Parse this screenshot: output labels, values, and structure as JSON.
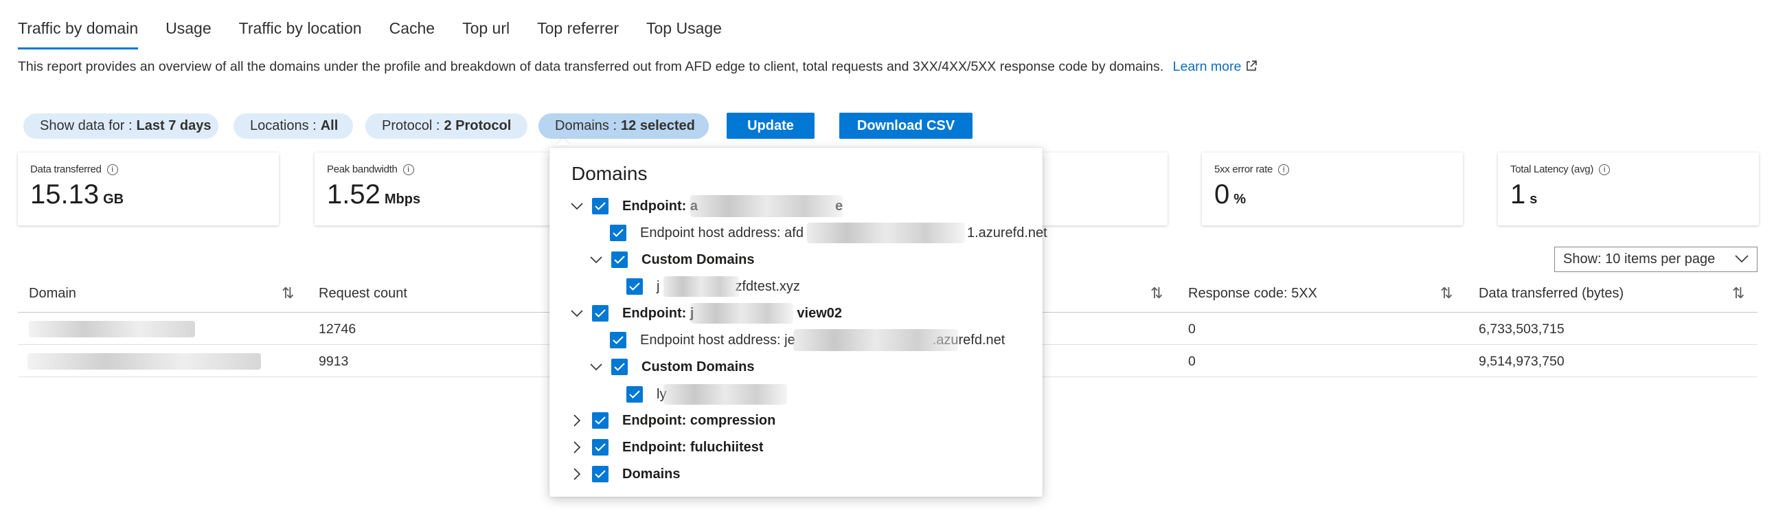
{
  "tabs": [
    {
      "label": "Traffic by domain",
      "active": true
    },
    {
      "label": "Usage"
    },
    {
      "label": "Traffic by location"
    },
    {
      "label": "Cache"
    },
    {
      "label": "Top url"
    },
    {
      "label": "Top referrer"
    },
    {
      "label": "Top Usage"
    }
  ],
  "description": {
    "text": "This report provides an overview of all the domains under the profile and breakdown of data transferred out from AFD edge to client, total requests and 3XX/4XX/5XX response code by domains.",
    "link": "Learn more"
  },
  "filters": {
    "show_data_for": {
      "label": "Show data for :",
      "value": "Last 7 days"
    },
    "locations": {
      "label": "Locations :",
      "value": "All"
    },
    "protocol": {
      "label": "Protocol :",
      "value": "2 Protocol"
    },
    "domains": {
      "label": "Domains :",
      "value": "12 selected"
    }
  },
  "buttons": {
    "update": "Update",
    "download_csv": "Download CSV"
  },
  "metrics": {
    "data_transferred": {
      "label": "Data transferred",
      "value": "15.13",
      "unit": "GB"
    },
    "peak_bandwidth": {
      "label": "Peak bandwidth",
      "value": "1.52",
      "unit": "Mbps"
    },
    "error_5xx": {
      "label": "5xx error rate",
      "value": "0",
      "unit": "%"
    },
    "latency": {
      "label": "Total Latency (avg)",
      "value": "1",
      "unit": "s"
    }
  },
  "page_size": {
    "value": "Show: 10 items per page"
  },
  "table": {
    "headers": {
      "domain": "Domain",
      "request_count": "Request count",
      "response_5xx": "Response code: 5XX",
      "data_transferred": "Data transferred (bytes)"
    },
    "rows": [
      {
        "request_count": "12746",
        "response_5xx": "0",
        "data_transferred": "6,733,503,715"
      },
      {
        "request_count": "9913",
        "response_5xx": "0",
        "data_transferred": "9,514,973,750"
      }
    ]
  },
  "domains_panel": {
    "title": "Domains",
    "items": [
      {
        "label": "Endpoint: a",
        "tail": "e",
        "bold": true
      },
      {
        "label": "Endpoint host address: afd",
        "tail": "1.azurefd.net",
        "bold": false
      },
      {
        "label": "Custom Domains",
        "tail": "",
        "bold": true
      },
      {
        "label": "j",
        "tail": "zfdtest.xyz",
        "bold": false
      },
      {
        "label": "Endpoint: j",
        "tail": "view02",
        "bold": true
      },
      {
        "label": "Endpoint host address: je",
        "tail": ".azurefd.net",
        "bold": false
      },
      {
        "label": "Custom Domains",
        "tail": "",
        "bold": true
      },
      {
        "label": "ly",
        "tail": "",
        "bold": false
      },
      {
        "label": "Endpoint: compression",
        "tail": "",
        "bold": true
      },
      {
        "label": "Endpoint: fuluchiitest",
        "tail": "",
        "bold": true
      },
      {
        "label": "Domains",
        "tail": "",
        "bold": true
      }
    ]
  },
  "colors": {
    "accent": "#0078d4",
    "pill": "#deecf9",
    "pill_selected": "#b7d4f0"
  }
}
